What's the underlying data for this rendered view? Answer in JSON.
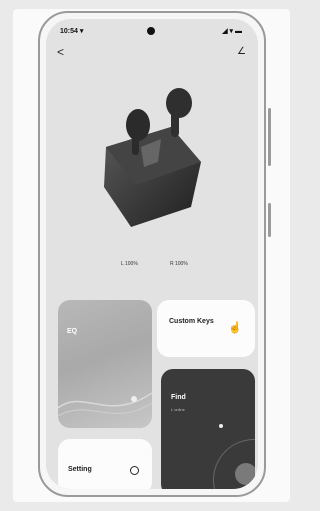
{
  "status": {
    "time": "10:54 ▾",
    "icons": "◢ ▾ ▬"
  },
  "nav": {
    "back": "<",
    "edit": "∠"
  },
  "battery": {
    "left": "L 100%",
    "right": "R 100%"
  },
  "cards": {
    "eq": {
      "title": "EQ"
    },
    "custom_keys": {
      "title": "Custom Keys"
    },
    "find": {
      "title": "Find",
      "subtitle": "L online"
    },
    "setting": {
      "title": "Setting"
    }
  },
  "colors": {
    "screen": "#e2e2e2",
    "dark_card": "#3a3a3a",
    "earbud": "#2b2b2b"
  }
}
